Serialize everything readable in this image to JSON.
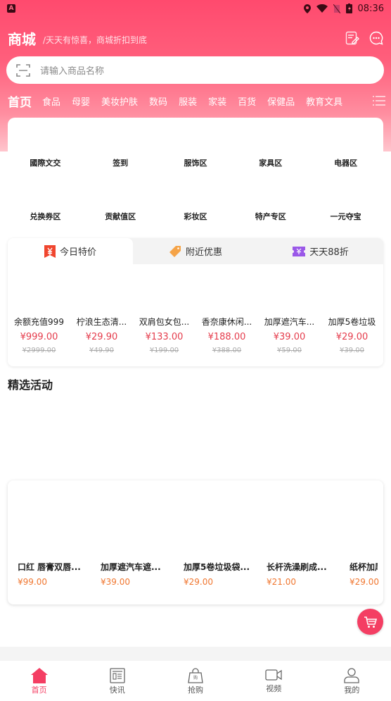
{
  "status_bar": {
    "time": "08:36"
  },
  "header": {
    "title": "商城",
    "subtitle": "/天天有惊喜，商城折扣到底"
  },
  "search": {
    "placeholder": "请输入商品名称"
  },
  "categories": [
    "首页",
    "食品",
    "母婴",
    "美妆护肤",
    "数码",
    "服装",
    "家装",
    "百货",
    "保健品",
    "教育文具"
  ],
  "grid": {
    "row1": [
      "國際文交",
      "签到",
      "服饰区",
      "家具区",
      "电器区"
    ],
    "row2": [
      "兑换券区",
      "贡献值区",
      "彩妆区",
      "特产专区",
      "一元夺宝"
    ]
  },
  "deal_tabs": [
    {
      "label": "今日特价",
      "icon": "yen-tag-icon",
      "active": true
    },
    {
      "label": "附近优惠",
      "icon": "coupon-tag-icon",
      "active": false
    },
    {
      "label": "天天88折",
      "icon": "ticket-icon",
      "active": false
    }
  ],
  "deals": [
    {
      "name": "余额充值999",
      "price": "¥999.00",
      "original": "¥2999.00"
    },
    {
      "name": "柠浪生态清...",
      "price": "¥29.90",
      "original": "¥49.90"
    },
    {
      "name": "双肩包女包...",
      "price": "¥133.00",
      "original": "¥199.00"
    },
    {
      "name": "香奈康休闲...",
      "price": "¥188.00",
      "original": "¥388.00"
    },
    {
      "name": "加厚遮汽车...",
      "price": "¥39.00",
      "original": "¥59.00"
    },
    {
      "name": "加厚5卷垃圾",
      "price": "¥29.00",
      "original": "¥39.00"
    }
  ],
  "featured": {
    "title": "精选活动",
    "items": [
      {
        "name": "口红 唇膏双唇...",
        "price": "¥99.00"
      },
      {
        "name": "加厚遮汽车遮...",
        "price": "¥39.00"
      },
      {
        "name": "加厚5卷垃圾袋...",
        "price": "¥29.00"
      },
      {
        "name": "长杆洗澡刷成...",
        "price": "¥21.00"
      },
      {
        "name": "纸杯加厚",
        "price": "¥29.00"
      }
    ]
  },
  "bottom_nav": [
    {
      "label": "首页",
      "icon": "home-icon",
      "active": true
    },
    {
      "label": "快讯",
      "icon": "news-icon",
      "active": false
    },
    {
      "label": "抢购",
      "icon": "shopping-bag-icon",
      "active": false
    },
    {
      "label": "视频",
      "icon": "video-icon",
      "active": false
    },
    {
      "label": "我的",
      "icon": "user-icon",
      "active": false
    }
  ],
  "colors": {
    "brand": "#f43e63",
    "price_red": "#e53c4c",
    "price_orange": "#f0762f"
  }
}
